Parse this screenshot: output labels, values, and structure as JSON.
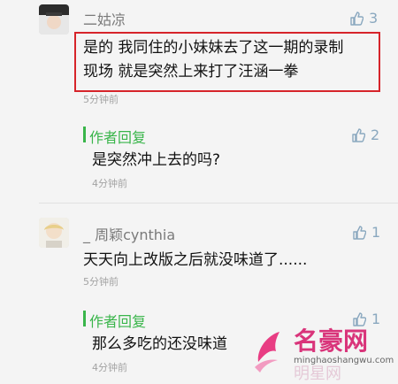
{
  "comments": [
    {
      "username": "二姑凉",
      "likes": "3",
      "text_lines": [
        "是的 我同住的小妹妹去了这一期的录制",
        "现场 就是突然上来打了汪涵一拳"
      ],
      "time": "5分钟前",
      "reply": {
        "author": "作者回复",
        "likes": "2",
        "text": "是突然冲上去的吗?",
        "time": "4分钟前"
      }
    },
    {
      "username": "_ 周颖cynthia",
      "likes": "1",
      "text": "天天向上改版之后就没味道了......",
      "time": "5分钟前",
      "reply": {
        "author": "作者回复",
        "likes": "1",
        "text": "那么多吃的还没味道",
        "time": "4分钟前"
      }
    }
  ],
  "watermark": {
    "brand": "名豪网",
    "url": "minghaoshangwu.com",
    "overlay": "明星网"
  },
  "colors": {
    "highlight_border": "#d6242a",
    "reply_green": "#39b54a",
    "like_blue": "#8aa8bf"
  },
  "icons": {
    "like": "thumbs-up-icon"
  }
}
